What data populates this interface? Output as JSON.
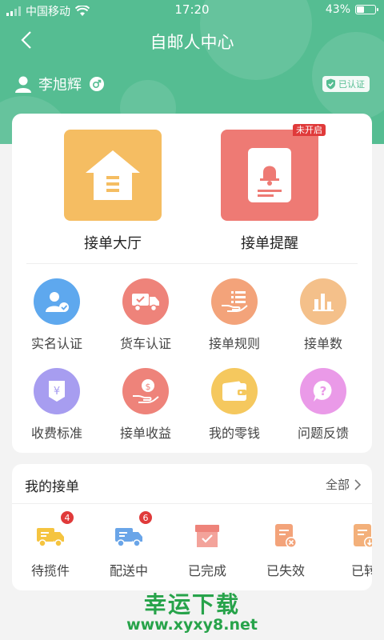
{
  "status": {
    "carrier": "中国移动",
    "time": "17:20",
    "battery": "43%"
  },
  "nav": {
    "title": "自邮人中心"
  },
  "user": {
    "name": "李旭辉",
    "verified": "已认证"
  },
  "big_items": [
    {
      "label": "接单大厅",
      "color": "#f5bd62"
    },
    {
      "label": "接单提醒",
      "color": "#ee7a74",
      "tag": "未开启"
    }
  ],
  "grid": [
    {
      "label": "实名认证",
      "icon": "id-card-icon",
      "color": "#5ea8ee"
    },
    {
      "label": "货车认证",
      "icon": "truck-icon",
      "color": "#ee837a"
    },
    {
      "label": "接单规则",
      "icon": "rules-hand-icon",
      "color": "#f3a37a"
    },
    {
      "label": "接单数",
      "icon": "bar-chart-icon",
      "color": "#f4c08a"
    },
    {
      "label": "收费标准",
      "icon": "yen-icon",
      "color": "#a79df0"
    },
    {
      "label": "接单收益",
      "icon": "money-hand-icon",
      "color": "#ee837a"
    },
    {
      "label": "我的零钱",
      "icon": "wallet-icon",
      "color": "#f5c85e"
    },
    {
      "label": "问题反馈",
      "icon": "question-icon",
      "color": "#ea9ae8"
    }
  ],
  "orders": {
    "title": "我的接单",
    "all": "全部",
    "items": [
      {
        "label": "待揽件",
        "count": "4",
        "icon": "pickup-truck-icon",
        "color": "#f5c440"
      },
      {
        "label": "配送中",
        "count": "6",
        "icon": "delivery-truck-icon",
        "color": "#6aa5e8"
      },
      {
        "label": "已完成",
        "icon": "box-done-icon",
        "color": "#ee837a"
      },
      {
        "label": "已失效",
        "icon": "doc-expired-icon",
        "color": "#f3a37a"
      },
      {
        "label": "已转",
        "icon": "doc-transfer-icon",
        "color": "#f3b07a"
      }
    ]
  },
  "watermark": {
    "line1": "幸运下载",
    "line2": "www.xyxy8.net"
  }
}
